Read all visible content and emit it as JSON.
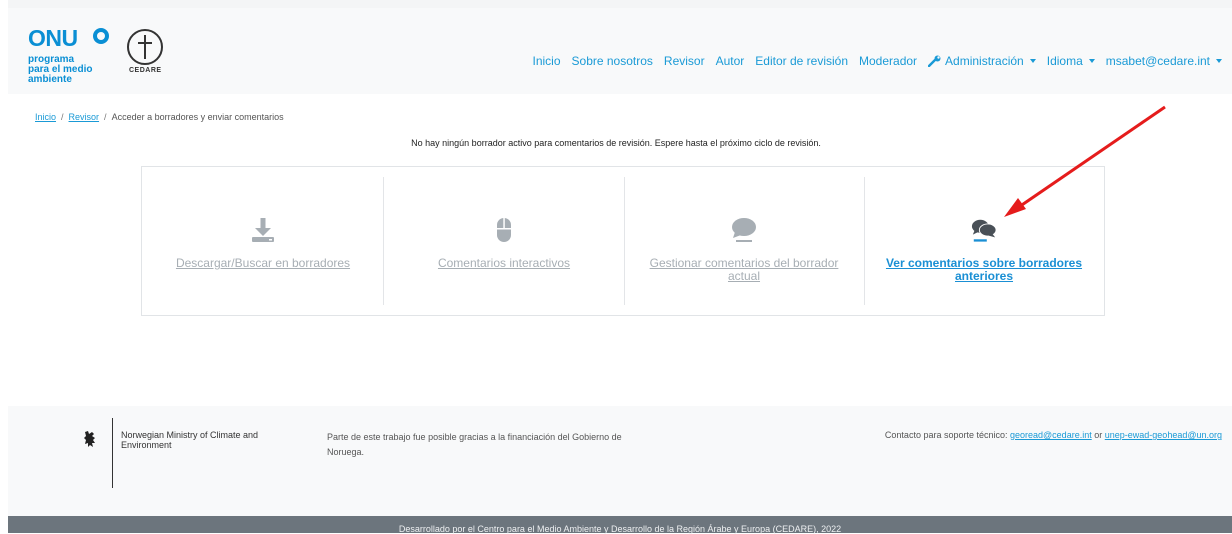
{
  "header": {
    "logo": {
      "onu": "ONU",
      "onu_subtitle": "programa para el medio ambiente",
      "cedare": "CEDARE"
    },
    "nav": {
      "inicio": "Inicio",
      "sobre": "Sobre nosotros",
      "revisor": "Revisor",
      "autor": "Autor",
      "editor": "Editor de revisión",
      "moderador": "Moderador",
      "administracion": "Administración",
      "idioma": "Idioma",
      "user": "msabet@cedare.int"
    }
  },
  "breadcrumb": {
    "home": "Inicio",
    "reviewer": "Revisor",
    "current": "Acceder a borradores y enviar comentarios"
  },
  "notice": "No hay ningún borrador activo para comentarios de revisión. Espere hasta el próximo ciclo de revisión.",
  "cards": [
    {
      "label": "Descargar/Buscar en borradores",
      "icon": "download-icon",
      "active": false
    },
    {
      "label": "Comentarios interactivos",
      "icon": "mouse-icon",
      "active": false
    },
    {
      "label": "Gestionar comentarios del borrador actual",
      "icon": "comment-icon",
      "active": false
    },
    {
      "label": "Ver comentarios sobre borradores anteriores",
      "icon": "comments-icon",
      "active": true
    }
  ],
  "footer": {
    "ministry": "Norwegian Ministry of Climate and Environment",
    "funding": "Parte de este trabajo fue posible gracias a la financiación del Gobierno de Noruega.",
    "contact_prefix": "Contacto para soporte técnico:",
    "contact_email1": "georead@cedare.int",
    "contact_or": "or",
    "contact_email2": "unep-ewad-geohead@un.org",
    "bottom": "Desarrollado por el Centro para el Medio Ambiente y Desarrollo de la Región Árabe y Europa (CEDARE), 2022"
  },
  "colors": {
    "accent": "#1a9ad6",
    "muted_link": "#a7aeb4",
    "arrow": "#e51c1c",
    "footer_bar": "#6c757d"
  }
}
